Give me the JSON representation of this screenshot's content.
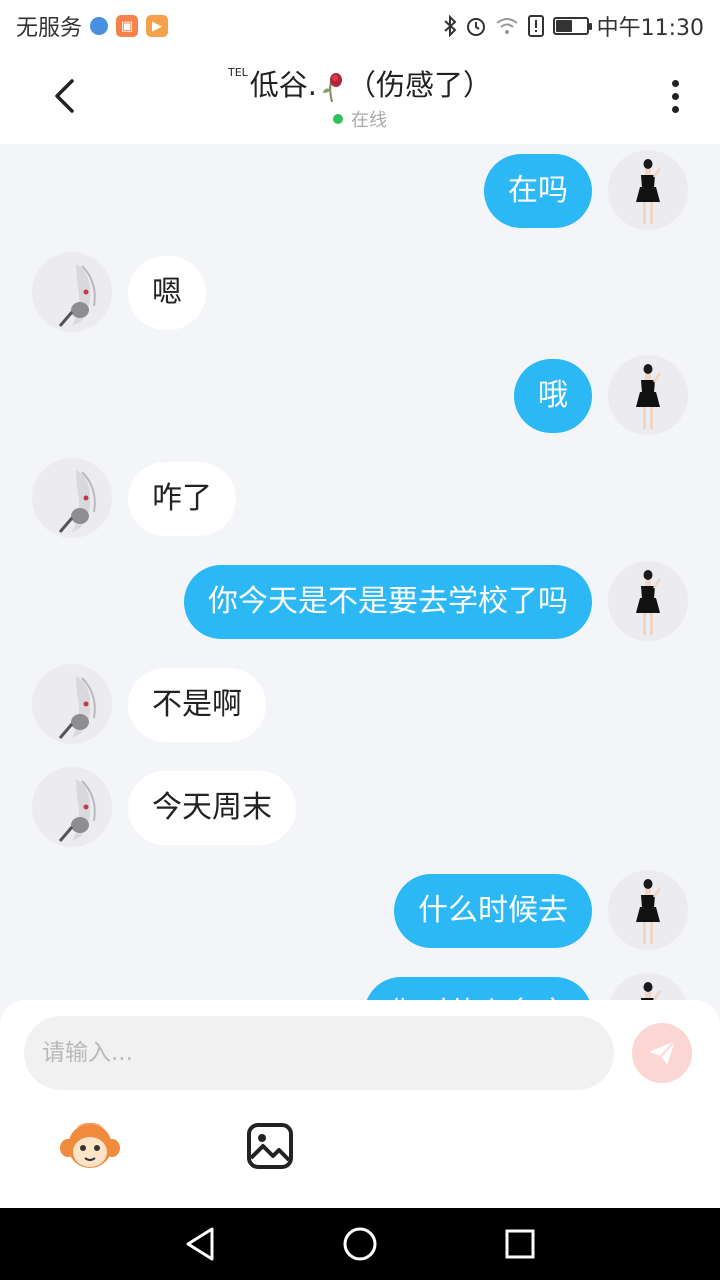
{
  "status_bar": {
    "carrier": "无服务",
    "time": "中午11:30",
    "battery_level": 0.55
  },
  "header": {
    "tel_tag": "TEL",
    "name_prefix": "低谷.",
    "name_suffix": "（伤感了）",
    "status": "在线",
    "status_color": "#2fc25b"
  },
  "messages": [
    {
      "side": "right",
      "text": "在吗"
    },
    {
      "side": "left",
      "text": "嗯"
    },
    {
      "side": "right",
      "text": "哦"
    },
    {
      "side": "left",
      "text": "咋了"
    },
    {
      "side": "right",
      "text": "你今天是不是要去学校了吗"
    },
    {
      "side": "left",
      "text": "不是啊"
    },
    {
      "side": "left",
      "text": "今天周末"
    },
    {
      "side": "right",
      "text": "什么时候去"
    },
    {
      "side": "right",
      "text": "你叫什么名字"
    }
  ],
  "composer": {
    "placeholder": "请输入...",
    "accent": "#2bb8f5"
  },
  "icons": {
    "back": "chevron-left-icon",
    "more": "more-vertical-icon",
    "send": "paper-plane-icon",
    "emoji": "monkey-emoji-icon",
    "image": "image-icon"
  }
}
